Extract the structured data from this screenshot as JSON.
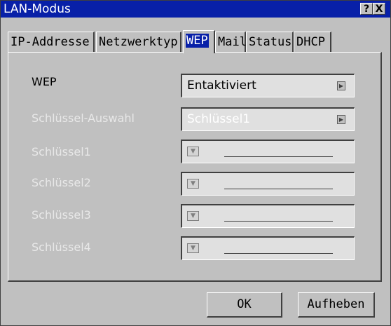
{
  "window": {
    "title": "LAN-Modus",
    "help_label": "?",
    "close_label": "X"
  },
  "tabs": [
    {
      "label": "IP-Addresse"
    },
    {
      "label": "Netzwerktyp"
    },
    {
      "label": "WEP",
      "active": true
    },
    {
      "label": "Mail"
    },
    {
      "label": "Status"
    },
    {
      "label": "DHCP"
    }
  ],
  "fields": {
    "wep": {
      "label": "WEP",
      "value": "Entaktiviert",
      "enabled": true
    },
    "key_select": {
      "label": "Schlüssel-Auswahl",
      "value": "Schlüssel1",
      "enabled": false
    },
    "key1": {
      "label": "Schlüssel1",
      "value": "",
      "enabled": false
    },
    "key2": {
      "label": "Schlüssel2",
      "value": "",
      "enabled": false
    },
    "key3": {
      "label": "Schlüssel3",
      "value": "",
      "enabled": false
    },
    "key4": {
      "label": "Schlüssel4",
      "value": "",
      "enabled": false
    }
  },
  "buttons": {
    "ok": "OK",
    "cancel": "Aufheben"
  },
  "icons": {
    "arrow_right": "play-right-icon",
    "key": "key-dropdown-icon"
  },
  "colors": {
    "titlebar": "#0820a8",
    "face": "#c0c0c0",
    "disabled_text": "#e8e8e8"
  }
}
